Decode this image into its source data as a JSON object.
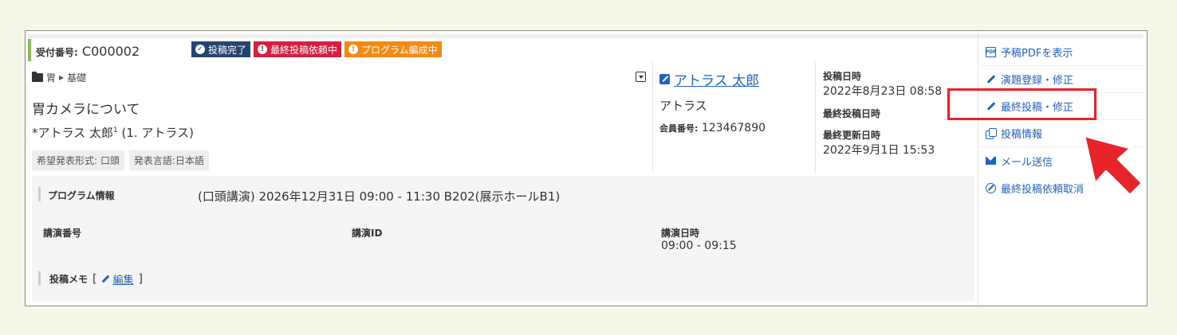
{
  "receipt": {
    "label": "受付番号:",
    "value": "C000002"
  },
  "badges": [
    {
      "icon": "check-circle-icon",
      "text": "投稿完了"
    },
    {
      "icon": "alert-circle-icon",
      "text": "最終投稿依頼中"
    },
    {
      "icon": "alert-circle-icon",
      "text": "プログラム編成中"
    }
  ],
  "breadcrumb": {
    "category": "胃",
    "sub": "基礎"
  },
  "abstract": {
    "title": "胃カメラについて",
    "authors": "*アトラス 太郎",
    "author_sup": "1",
    "affiliation": " (1. アトラス)",
    "tags": [
      "希望発表形式: 口頭",
      "発表言語:日本語"
    ]
  },
  "user": {
    "name": "アトラス 太郎",
    "org": "アトラス",
    "member_label": "会員番号:",
    "member_no": "123467890"
  },
  "dates": {
    "submitted_label": "投稿日時",
    "submitted_value": "2022年8月23日 08:58",
    "final_label": "最終投稿日時",
    "updated_label": "最終更新日時",
    "updated_value": "2022年9月1日 15:53"
  },
  "program": {
    "label": "プログラム情報",
    "value": "(口頭講演) 2026年12月31日 09:00 - 11:30 B202(展示ホールB1)",
    "col_number_label": "講演番号",
    "col_id_label": "講演ID",
    "col_datetime_label": "講演日時",
    "col_datetime_value": "09:00 - 09:15",
    "memo_label": "投稿メモ",
    "memo_open": "[",
    "memo_edit": "編集",
    "memo_close": "]"
  },
  "menu": [
    {
      "icon": "pdf-file-icon",
      "label": "予稿PDFを表示"
    },
    {
      "icon": "pencil-icon",
      "label": "演題登録・修正"
    },
    {
      "icon": "pencil-icon",
      "label": "最終投稿・修正"
    },
    {
      "icon": "copy-icon",
      "label": "投稿情報"
    },
    {
      "icon": "envelope-icon",
      "label": "メール送信"
    },
    {
      "icon": "ban-icon",
      "label": "最終投稿依頼取消"
    }
  ],
  "colors": {
    "badge_done": "#23456f",
    "badge_request": "#d6203e",
    "badge_program": "#f38a13",
    "link": "#1f63c6",
    "highlight": "#e8242b",
    "page_bg": "#f3f8e8"
  }
}
